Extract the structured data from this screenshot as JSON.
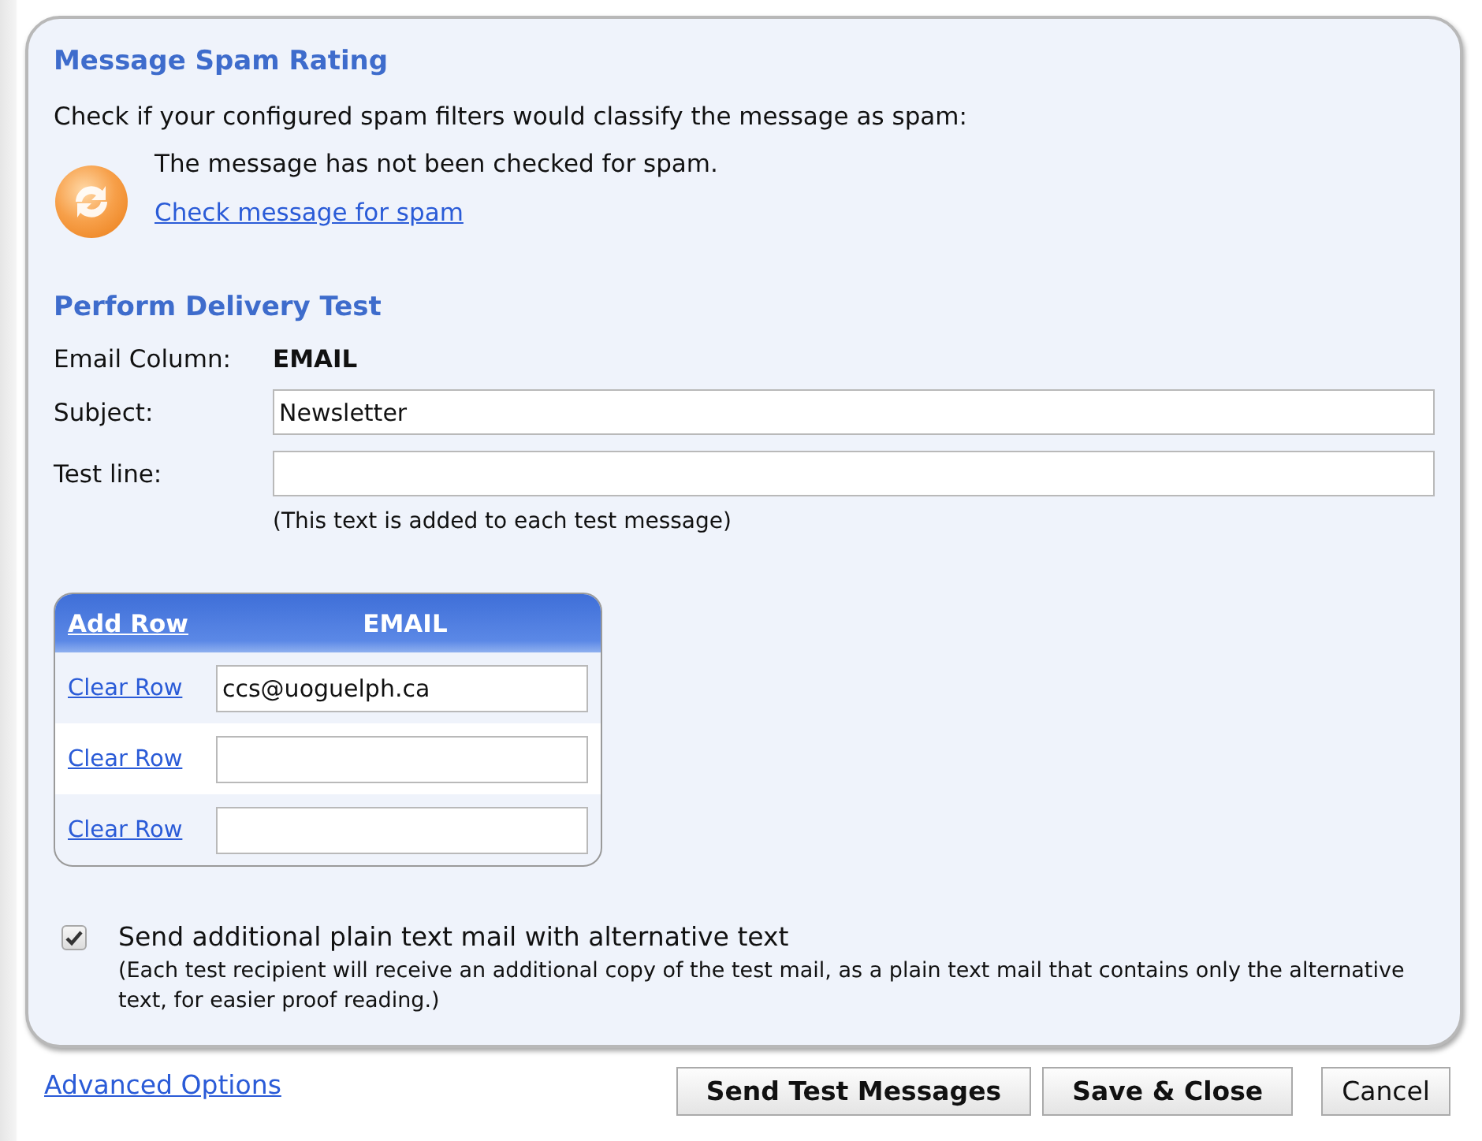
{
  "spam_rating": {
    "heading": "Message Spam Rating",
    "description": "Check if your configured spam filters would classify the message as spam:",
    "status": "The message has not been checked for spam.",
    "check_link": "Check message for spam"
  },
  "delivery_test": {
    "heading": "Perform Delivery Test",
    "email_column": {
      "label": "Email Column:",
      "value": "EMAIL"
    },
    "subject": {
      "label": "Subject:",
      "value": "Newsletter"
    },
    "test_line": {
      "label": "Test line:",
      "note": "(This text is added to each test message)"
    }
  },
  "recipients": {
    "add_row": "Add Row",
    "column": "EMAIL",
    "rows": [
      {
        "action": "Clear Row",
        "value": "ccs@uoguelph.ca"
      },
      {
        "action": "Clear Row"
      },
      {
        "action": "Clear Row"
      }
    ]
  },
  "plain_text_option": {
    "label": "Send additional plain text mail with alternative text",
    "checked": true,
    "note": "(Each test recipient will receive an additional copy of the test mail, as a plain text mail that contains only the alternative text, for easier proof reading.)"
  },
  "footer": {
    "advanced_link": "Advanced Options",
    "buttons": [
      {
        "label": "Send Test Messages",
        "kind": "primary"
      },
      {
        "label": "Save & Close",
        "kind": "primary"
      },
      {
        "label": "Cancel",
        "kind": "default"
      }
    ]
  }
}
